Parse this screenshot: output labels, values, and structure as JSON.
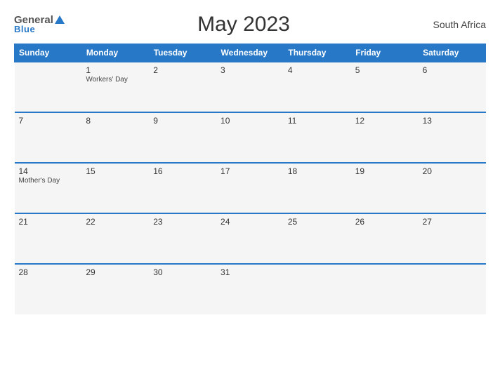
{
  "header": {
    "logo_general": "General",
    "logo_blue": "Blue",
    "title": "May 2023",
    "country": "South Africa"
  },
  "calendar": {
    "weekdays": [
      "Sunday",
      "Monday",
      "Tuesday",
      "Wednesday",
      "Thursday",
      "Friday",
      "Saturday"
    ],
    "weeks": [
      [
        {
          "day": "",
          "holiday": ""
        },
        {
          "day": "1",
          "holiday": "Workers' Day"
        },
        {
          "day": "2",
          "holiday": ""
        },
        {
          "day": "3",
          "holiday": ""
        },
        {
          "day": "4",
          "holiday": ""
        },
        {
          "day": "5",
          "holiday": ""
        },
        {
          "day": "6",
          "holiday": ""
        }
      ],
      [
        {
          "day": "7",
          "holiday": ""
        },
        {
          "day": "8",
          "holiday": ""
        },
        {
          "day": "9",
          "holiday": ""
        },
        {
          "day": "10",
          "holiday": ""
        },
        {
          "day": "11",
          "holiday": ""
        },
        {
          "day": "12",
          "holiday": ""
        },
        {
          "day": "13",
          "holiday": ""
        }
      ],
      [
        {
          "day": "14",
          "holiday": "Mother's Day"
        },
        {
          "day": "15",
          "holiday": ""
        },
        {
          "day": "16",
          "holiday": ""
        },
        {
          "day": "17",
          "holiday": ""
        },
        {
          "day": "18",
          "holiday": ""
        },
        {
          "day": "19",
          "holiday": ""
        },
        {
          "day": "20",
          "holiday": ""
        }
      ],
      [
        {
          "day": "21",
          "holiday": ""
        },
        {
          "day": "22",
          "holiday": ""
        },
        {
          "day": "23",
          "holiday": ""
        },
        {
          "day": "24",
          "holiday": ""
        },
        {
          "day": "25",
          "holiday": ""
        },
        {
          "day": "26",
          "holiday": ""
        },
        {
          "day": "27",
          "holiday": ""
        }
      ],
      [
        {
          "day": "28",
          "holiday": ""
        },
        {
          "day": "29",
          "holiday": ""
        },
        {
          "day": "30",
          "holiday": ""
        },
        {
          "day": "31",
          "holiday": ""
        },
        {
          "day": "",
          "holiday": ""
        },
        {
          "day": "",
          "holiday": ""
        },
        {
          "day": "",
          "holiday": ""
        }
      ]
    ]
  }
}
